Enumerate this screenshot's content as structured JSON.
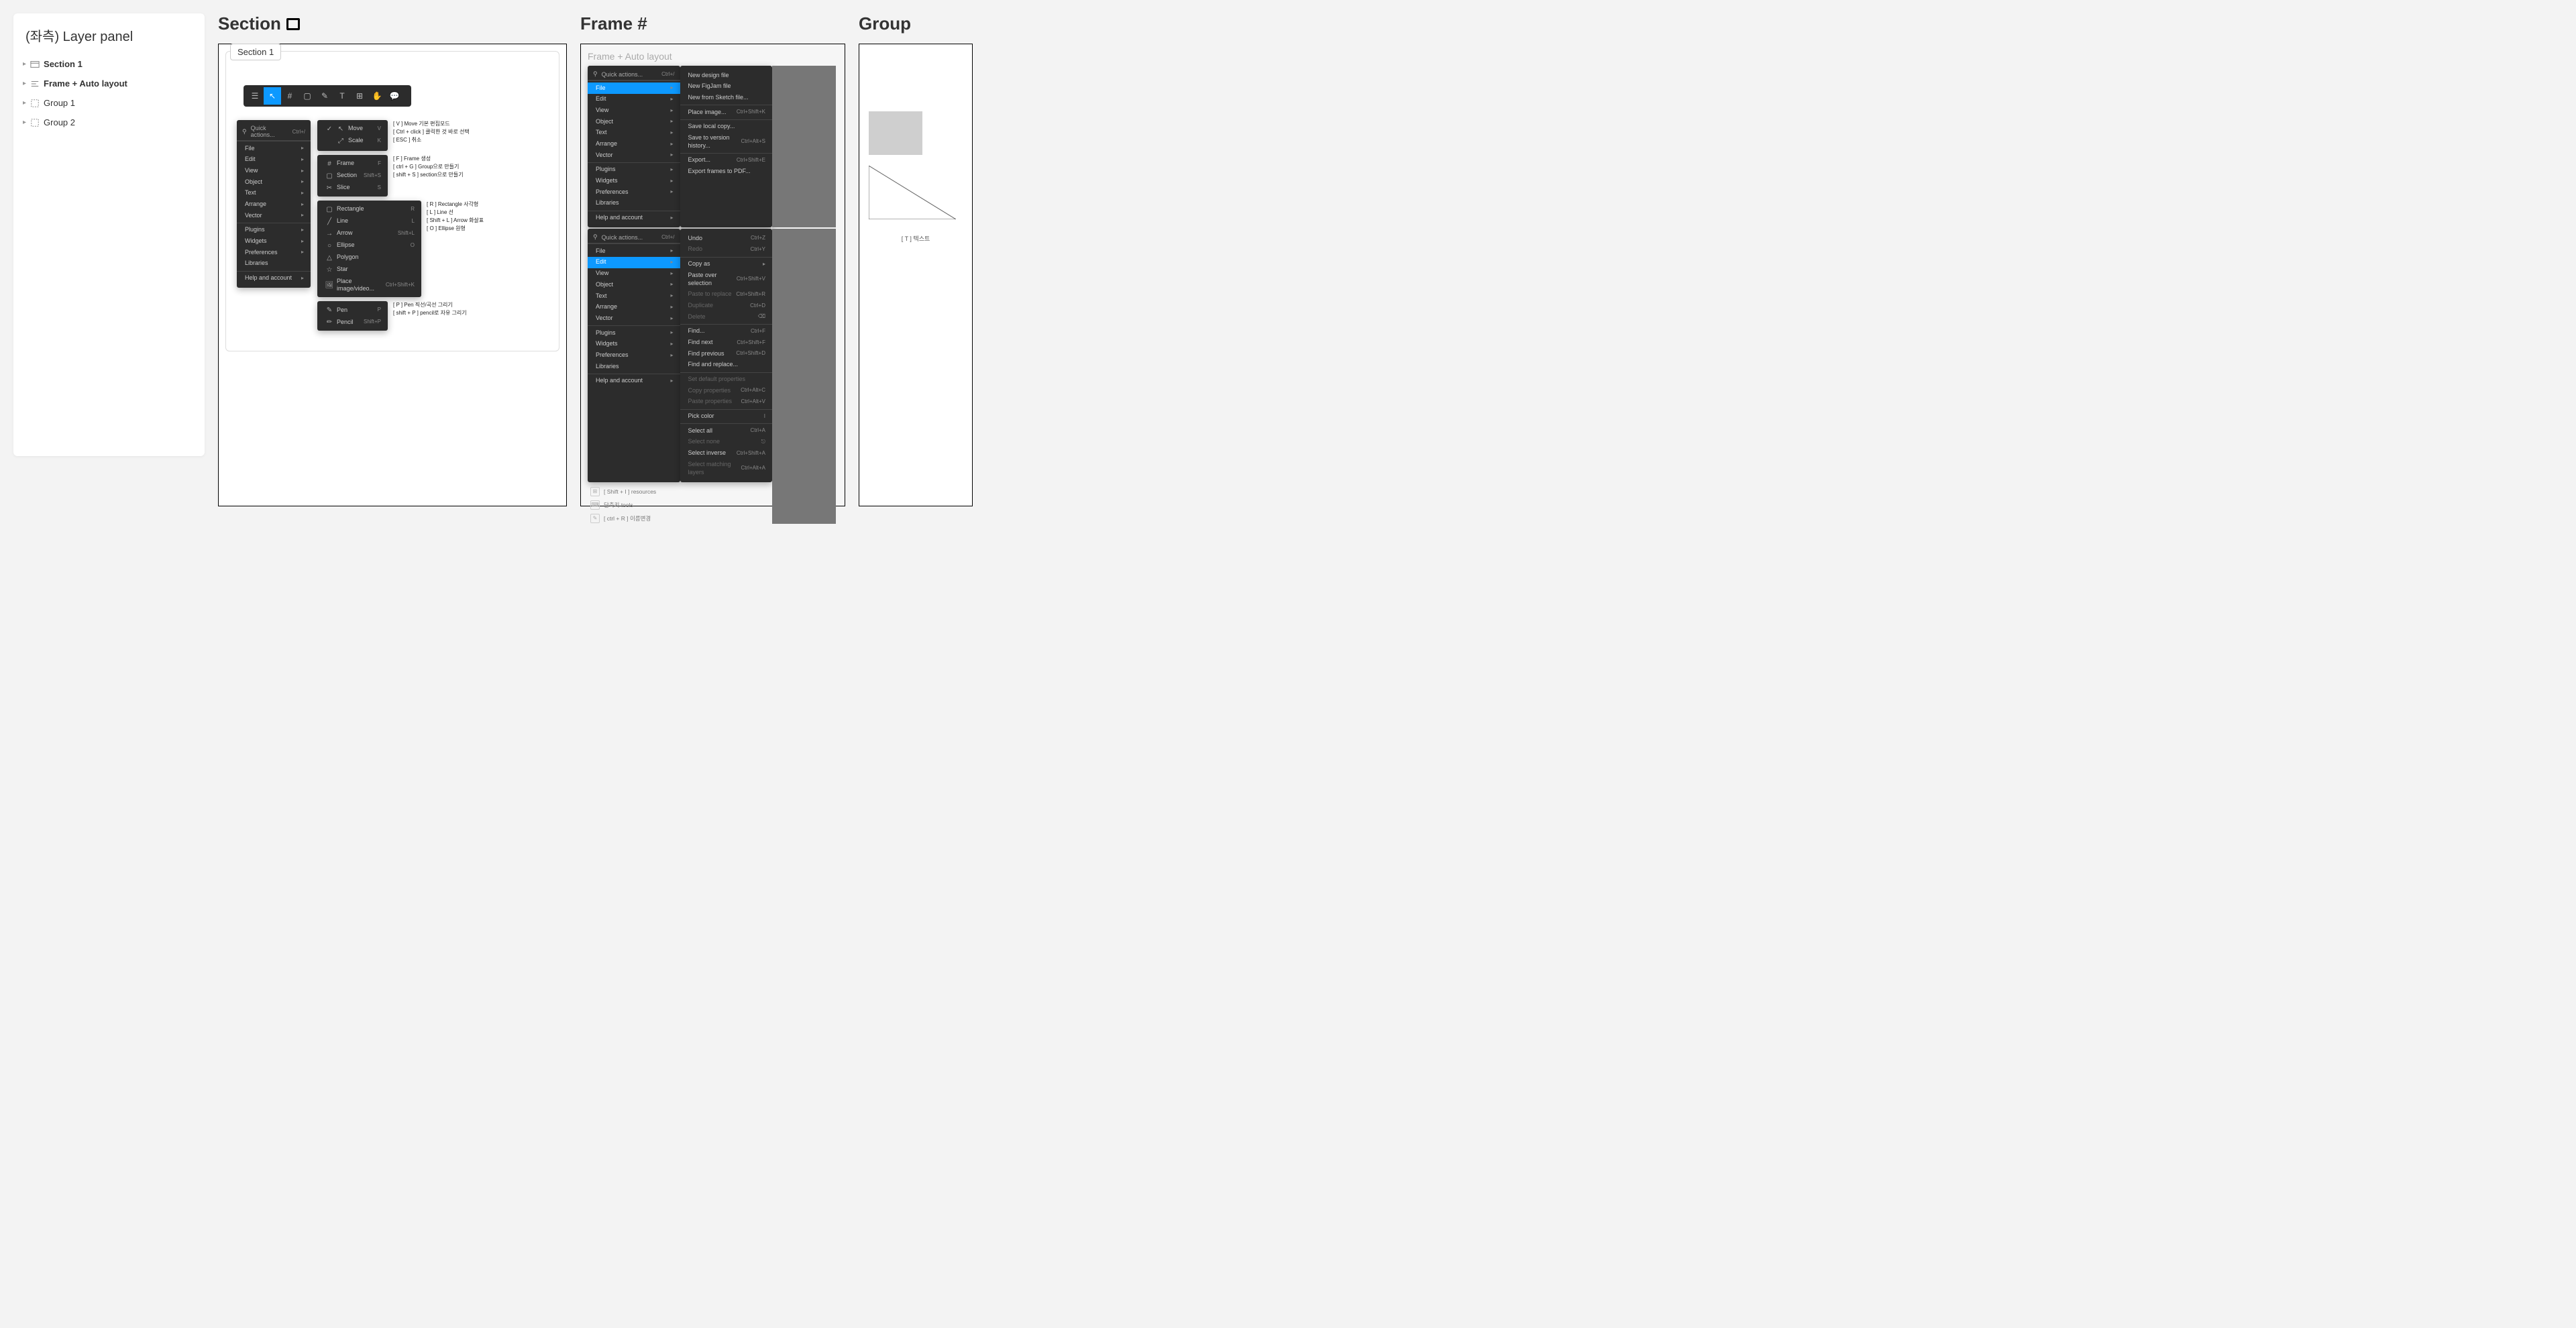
{
  "layer_panel": {
    "title": "(좌측) Layer panel",
    "rows": [
      "Section 1",
      "Frame + Auto layout",
      "Group 1",
      "Group 2"
    ]
  },
  "section": {
    "title": "Section",
    "tab_label": "Section 1",
    "main_menu": {
      "quick": "Quick actions...",
      "quick_kb": "Ctrl+/",
      "group_a": [
        "File",
        "Edit",
        "View",
        "Object",
        "Text",
        "Arrange",
        "Vector"
      ],
      "group_b": [
        "Plugins",
        "Widgets",
        "Preferences",
        "Libraries"
      ],
      "group_c": [
        "Help and account"
      ]
    },
    "tool_move": {
      "items": [
        {
          "ico": "↖",
          "label": "Move",
          "kb": "V"
        },
        {
          "ico": "⤢",
          "label": "Scale",
          "kb": "K"
        }
      ],
      "annot": [
        "[ V ] Move 기본 편집모드",
        "[ Ctrl + click ] 클릭한 것 바로 선택",
        "[ ESC ] 취소"
      ]
    },
    "tool_frame": {
      "items": [
        {
          "ico": "#",
          "label": "Frame",
          "kb": "F"
        },
        {
          "ico": "▢",
          "label": "Section",
          "kb": "Shift+S"
        },
        {
          "ico": "✂",
          "label": "Slice",
          "kb": "S"
        }
      ],
      "annot": [
        "[ F ] Frame 생성",
        "[ ctrl + G ] Group으로 만들기",
        "[ shift + S ] section으로 만들기"
      ]
    },
    "tool_shape": {
      "items": [
        {
          "ico": "▢",
          "label": "Rectangle",
          "kb": "R"
        },
        {
          "ico": "╱",
          "label": "Line",
          "kb": "L"
        },
        {
          "ico": "→",
          "label": "Arrow",
          "kb": "Shift+L"
        },
        {
          "ico": "○",
          "label": "Ellipse",
          "kb": "O"
        },
        {
          "ico": "△",
          "label": "Polygon",
          "kb": ""
        },
        {
          "ico": "☆",
          "label": "Star",
          "kb": ""
        },
        {
          "ico": "🖼",
          "label": "Place image/video...",
          "kb": "Ctrl+Shift+K"
        }
      ],
      "annot": [
        "[ R ] Rectangle 사각형",
        "[ L ] Line 선",
        "[ Shift + L ] Arrow 화살표",
        "[ O ] Ellipse 원형"
      ]
    },
    "tool_pen": {
      "items": [
        {
          "ico": "✎",
          "label": "Pen",
          "kb": "P"
        },
        {
          "ico": "✏",
          "label": "Pencil",
          "kb": "Shift+P"
        }
      ],
      "annot": [
        "[ P ] Pen 직선/곡선 그리기",
        "[ shift + P ] pencil로 자유 그리기"
      ]
    }
  },
  "frame": {
    "title": "Frame #",
    "header": "Frame + Auto layout",
    "quick": "Quick actions...",
    "quick_kb": "Ctrl+/",
    "main_menu_groups": {
      "a": [
        "File",
        "Edit",
        "View",
        "Object",
        "Text",
        "Arrange",
        "Vector"
      ],
      "b": [
        "Plugins",
        "Widgets",
        "Preferences",
        "Libraries"
      ],
      "c": [
        "Help and account"
      ]
    },
    "file_submenu": {
      "a": [
        {
          "label": "New design file",
          "kb": ""
        },
        {
          "label": "New FigJam file",
          "kb": ""
        },
        {
          "label": "New from Sketch file...",
          "kb": ""
        }
      ],
      "b": [
        {
          "label": "Place image...",
          "kb": "Ctrl+Shift+K"
        }
      ],
      "c": [
        {
          "label": "Save local copy...",
          "kb": ""
        },
        {
          "label": "Save to version history...",
          "kb": "Ctrl+Alt+S"
        }
      ],
      "d": [
        {
          "label": "Export...",
          "kb": "Ctrl+Shift+E"
        },
        {
          "label": "Export frames to PDF...",
          "kb": ""
        }
      ]
    },
    "edit_submenu": {
      "a": [
        {
          "label": "Undo",
          "kb": "Ctrl+Z",
          "dim": false
        },
        {
          "label": "Redo",
          "kb": "Ctrl+Y",
          "dim": true
        }
      ],
      "b": [
        {
          "label": "Copy as",
          "kb": "▸",
          "dim": false
        },
        {
          "label": "Paste over selection",
          "kb": "Ctrl+Shift+V",
          "dim": false
        },
        {
          "label": "Paste to replace",
          "kb": "Ctrl+Shift+R",
          "dim": true
        },
        {
          "label": "Duplicate",
          "kb": "Ctrl+D",
          "dim": true
        },
        {
          "label": "Delete",
          "kb": "⌫",
          "dim": true
        }
      ],
      "c": [
        {
          "label": "Find...",
          "kb": "Ctrl+F",
          "dim": false
        },
        {
          "label": "Find next",
          "kb": "Ctrl+Shift+F",
          "dim": false
        },
        {
          "label": "Find previous",
          "kb": "Ctrl+Shift+D",
          "dim": false
        },
        {
          "label": "Find and replace...",
          "kb": "",
          "dim": false
        }
      ],
      "d": [
        {
          "label": "Set default properties",
          "kb": "",
          "dim": true
        },
        {
          "label": "Copy properties",
          "kb": "Ctrl+Alt+C",
          "dim": true
        },
        {
          "label": "Paste properties",
          "kb": "Ctrl+Alt+V",
          "dim": true
        }
      ],
      "e": [
        {
          "label": "Pick color",
          "kb": "I",
          "dim": false
        }
      ],
      "f": [
        {
          "label": "Select all",
          "kb": "Ctrl+A",
          "dim": false
        },
        {
          "label": "Select none",
          "kb": "⎋",
          "dim": true
        },
        {
          "label": "Select inverse",
          "kb": "Ctrl+Shift+A",
          "dim": false
        },
        {
          "label": "Select matching layers",
          "kb": "Ctrl+Alt+A",
          "dim": true
        }
      ]
    },
    "notes": [
      {
        "label": "[ Shift + I ] resources"
      },
      {
        "label": "단축키 tools"
      },
      {
        "label": "[ ctrl + R ] 이름변경"
      }
    ]
  },
  "group": {
    "title": "Group",
    "text_label": "[ T ] 텍스트"
  }
}
